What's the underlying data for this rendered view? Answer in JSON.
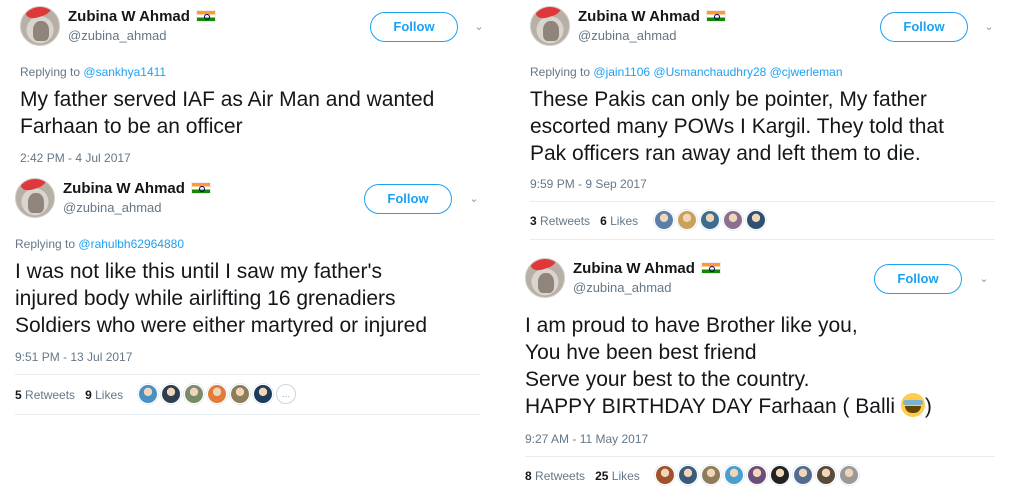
{
  "tweets": [
    {
      "name": "Zubina W Ahmad",
      "handle": "@zubina_ahmad",
      "follow_label": "Follow",
      "replying_prefix": "Replying to",
      "replying_to": "@sankhya1411",
      "lines": [
        "My father served IAF as Air Man and wanted",
        "Farhaan to be an officer"
      ],
      "time": "2:42 PM - 4 Jul 2017"
    },
    {
      "name": "Zubina W Ahmad",
      "handle": "@zubina_ahmad",
      "follow_label": "Follow",
      "replying_prefix": "Replying to",
      "replying_to": "@rahulbh62964880",
      "lines": [
        "I was not like this until I saw my father's",
        "injured body while airlifting 16 grenadiers",
        "Soldiers who were either martyred or injured"
      ],
      "time": "9:51 PM - 13 Jul 2017",
      "retweets": "5",
      "retweets_label": "Retweets",
      "likes": "9",
      "likes_label": "Likes",
      "face_colors": [
        "#4a90c2",
        "#2c3e50",
        "#7a8b6a",
        "#e07b39",
        "#8e7d5b",
        "#1f3b5c"
      ]
    },
    {
      "name": "Zubina W Ahmad",
      "handle": "@zubina_ahmad",
      "follow_label": "Follow",
      "replying_prefix": "Replying to",
      "replying_to": "@jain1106 @Usmanchaudhry28 @cjwerleman",
      "lines": [
        "These Pakis can only be pointer, My father",
        "escorted many POWs I Kargil. They told that",
        "Pak officers ran away and left them to die."
      ],
      "time": "9:59 PM - 9 Sep 2017",
      "retweets": "3",
      "retweets_label": "Retweets",
      "likes": "6",
      "likes_label": "Likes",
      "face_colors": [
        "#5b7fa6",
        "#c9a25a",
        "#3d6e8f",
        "#8a6f8f",
        "#2f4f6f"
      ]
    },
    {
      "name": "Zubina W Ahmad",
      "handle": "@zubina_ahmad",
      "follow_label": "Follow",
      "lines": [
        "I am proud to have Brother like you,",
        "You hve been best friend",
        "Serve your best to the country.",
        "HAPPY BIRTHDAY DAY Farhaan ( Balli"
      ],
      "line4_end": ")",
      "emoji_name": "face-with-tears-of-joy",
      "time": "9:27 AM - 11 May 2017",
      "retweets": "8",
      "retweets_label": "Retweets",
      "likes": "25",
      "likes_label": "Likes",
      "face_colors": [
        "#a0522d",
        "#3b5b7a",
        "#8f7a5a",
        "#4a9fd0",
        "#6b4f7a",
        "#222222",
        "#556b8f",
        "#5a4a3a",
        "#9a9a9a"
      ]
    }
  ],
  "colors": {
    "accent": "#1da1f2",
    "muted": "#657786",
    "text": "#14171a",
    "divider": "#e6ecf0"
  }
}
